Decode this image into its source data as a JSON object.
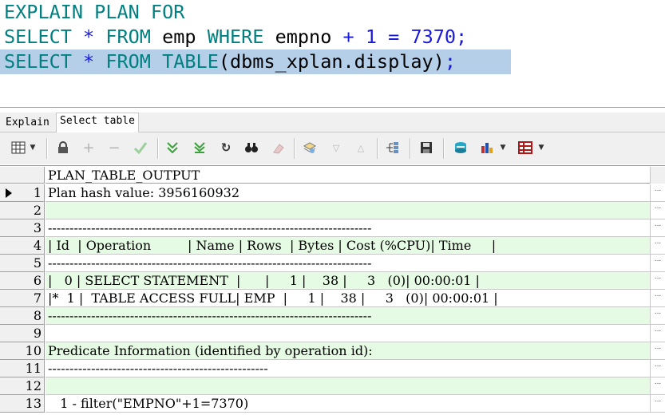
{
  "editor": {
    "line1": [
      {
        "t": "EXPLAIN PLAN FOR",
        "c": "kw"
      }
    ],
    "line2": [
      {
        "t": "SELECT",
        "c": "kw"
      },
      {
        "t": " ",
        "c": "pl"
      },
      {
        "t": "*",
        "c": "op"
      },
      {
        "t": " ",
        "c": "pl"
      },
      {
        "t": "FROM",
        "c": "kw"
      },
      {
        "t": " emp ",
        "c": "pl"
      },
      {
        "t": "WHERE",
        "c": "kw"
      },
      {
        "t": " empno ",
        "c": "pl"
      },
      {
        "t": "+",
        "c": "op"
      },
      {
        "t": " ",
        "c": "pl"
      },
      {
        "t": "1",
        "c": "num"
      },
      {
        "t": " ",
        "c": "pl"
      },
      {
        "t": "=",
        "c": "op"
      },
      {
        "t": " ",
        "c": "pl"
      },
      {
        "t": "7370",
        "c": "num"
      },
      {
        "t": ";",
        "c": "op"
      }
    ],
    "line3": [
      {
        "t": "SELECT",
        "c": "kw"
      },
      {
        "t": " ",
        "c": "pl"
      },
      {
        "t": "*",
        "c": "op"
      },
      {
        "t": " ",
        "c": "pl"
      },
      {
        "t": "FROM",
        "c": "kw"
      },
      {
        "t": " ",
        "c": "pl"
      },
      {
        "t": "TABLE",
        "c": "kw"
      },
      {
        "t": "(dbms_xplan.display)",
        "c": "pl"
      },
      {
        "t": ";",
        "c": "op"
      }
    ]
  },
  "tabs": {
    "explain": "Explain",
    "select_table": "Select table"
  },
  "toolbar": {
    "icons": [
      "grid-view-icon",
      "lock-icon",
      "add-record-icon",
      "delete-record-icon",
      "post-edit-icon",
      "fetch-next-icon",
      "fetch-last-icon",
      "refresh-icon",
      "find-icon",
      "clear-icon",
      "query-by-example-icon",
      "sort-desc-icon",
      "sort-asc-icon",
      "link-icon",
      "save-icon",
      "export-icon",
      "chart-icon",
      "print-table-icon"
    ]
  },
  "colors": {
    "keyword": "#008080",
    "operator": "#1a1adc",
    "highlight": "#b5cfe9",
    "row_green": "#e6fbe3"
  },
  "grid": {
    "column_header": "PLAN_TABLE_OUTPUT",
    "rows": [
      {
        "n": "1",
        "text": "Plan hash value: 3956160932",
        "green": false
      },
      {
        "n": "2",
        "text": "",
        "green": true
      },
      {
        "n": "3",
        "text": "---------------------------------------------------------------------------",
        "green": false
      },
      {
        "n": "4",
        "text": "| Id  | Operation         | Name | Rows  | Bytes | Cost (%CPU)| Time     |",
        "green": true
      },
      {
        "n": "5",
        "text": "---------------------------------------------------------------------------",
        "green": false
      },
      {
        "n": "6",
        "text": "|   0 | SELECT STATEMENT  |      |     1 |    38 |     3   (0)| 00:00:01 |",
        "green": true
      },
      {
        "n": "7",
        "text": "|*  1 |  TABLE ACCESS FULL| EMP  |     1 |    38 |     3   (0)| 00:00:01 |",
        "green": false
      },
      {
        "n": "8",
        "text": "---------------------------------------------------------------------------",
        "green": true
      },
      {
        "n": "9",
        "text": "",
        "green": false
      },
      {
        "n": "10",
        "text": "Predicate Information (identified by operation id):",
        "green": true
      },
      {
        "n": "11",
        "text": "---------------------------------------------------",
        "green": false
      },
      {
        "n": "12",
        "text": "",
        "green": true
      },
      {
        "n": "13",
        "text": "   1 - filter(\"EMPNO\"+1=7370)",
        "green": false
      }
    ],
    "ellipsis": "..."
  }
}
